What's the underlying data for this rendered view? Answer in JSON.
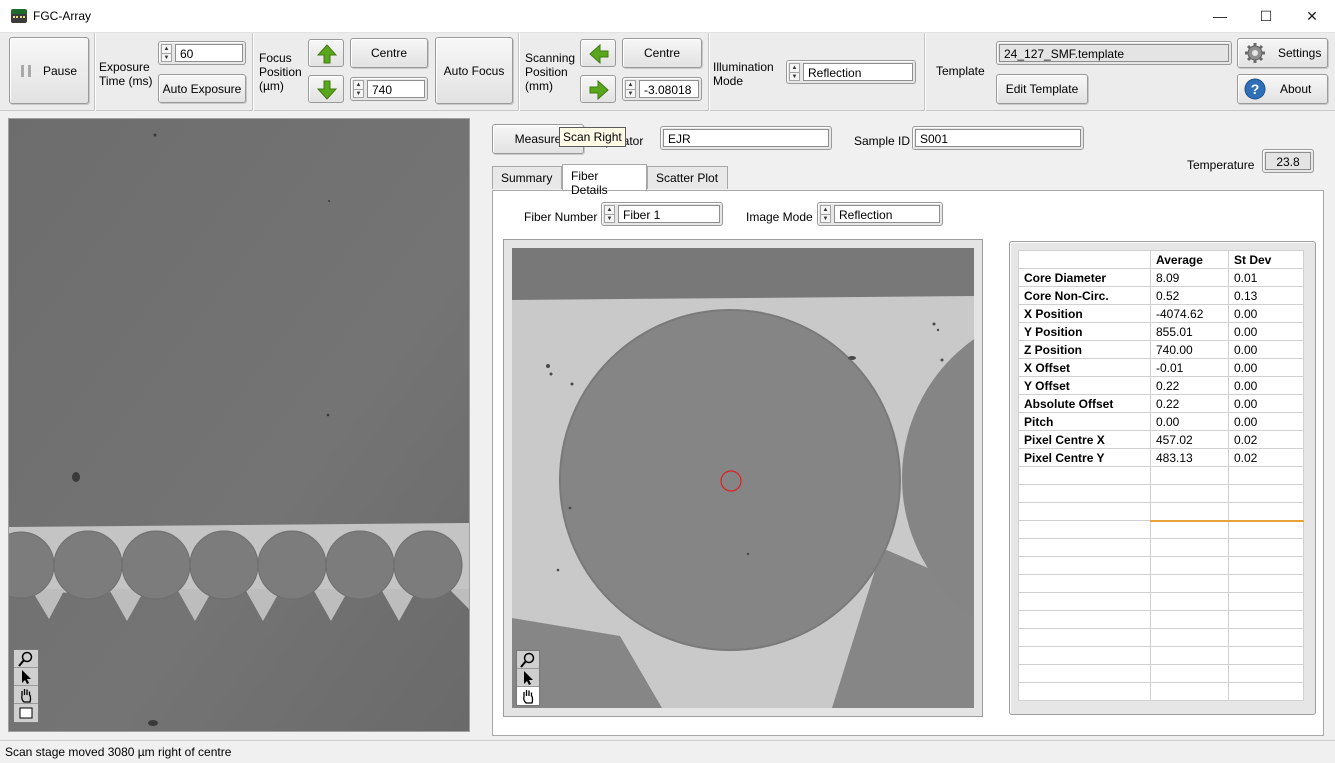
{
  "window": {
    "title": "FGC-Array",
    "controls": [
      "—",
      "☐",
      "✕"
    ]
  },
  "toolbar": {
    "pause_label": "Pause",
    "exposure_label": "Exposure Time (ms)",
    "exposure_value": "60",
    "auto_exposure_label": "Auto Exposure",
    "focus_label": "Focus Position (µm)",
    "focus_centre_label": "Centre",
    "focus_value": "740",
    "auto_focus_label": "Auto Focus",
    "scan_label": "Scanning Position (mm)",
    "scan_centre_label": "Centre",
    "scan_value": "-3.08018",
    "illumination_label": "Illumination Mode",
    "illumination_value": "Reflection",
    "template_label": "Template",
    "template_value": "24_127_SMF.template",
    "edit_template_label": "Edit Template",
    "settings_label": "Settings",
    "about_label": "About"
  },
  "measure": {
    "measure_label": "Measure",
    "operator_label": "Operator",
    "operator_value": "EJR",
    "sample_label": "Sample ID",
    "sample_value": "S001",
    "temperature_label": "Temperature",
    "temperature_value": "23.8"
  },
  "tooltip": "Scan Right",
  "tabs": [
    {
      "label": "Summary",
      "active": false
    },
    {
      "label": "Fiber Details",
      "active": true
    },
    {
      "label": "Scatter Plot",
      "active": false
    }
  ],
  "fiber_details": {
    "fiber_number_label": "Fiber Number",
    "fiber_number_value": "Fiber 1",
    "image_mode_label": "Image Mode",
    "image_mode_value": "Reflection"
  },
  "stats_table": {
    "headers": [
      "",
      "Average",
      "St Dev"
    ],
    "rows": [
      [
        "Core Diameter",
        "8.09",
        "0.01"
      ],
      [
        "Core Non-Circ.",
        "0.52",
        "0.13"
      ],
      [
        "X Position",
        "-4074.62",
        "0.00"
      ],
      [
        "Y Position",
        "855.01",
        "0.00"
      ],
      [
        "Z Position",
        "740.00",
        "0.00"
      ],
      [
        "X Offset",
        "-0.01",
        "0.00"
      ],
      [
        "Y Offset",
        "0.22",
        "0.00"
      ],
      [
        "Absolute Offset",
        "0.22",
        "0.00"
      ],
      [
        "Pitch",
        "0.00",
        "0.00"
      ],
      [
        "Pixel Centre X",
        "457.02",
        "0.02"
      ],
      [
        "Pixel Centre Y",
        "483.13",
        "0.02"
      ]
    ]
  },
  "status": "Scan stage moved 3080 µm right of centre",
  "colors": {
    "arrow_green": "#5aa61c",
    "marker_red": "#e02020",
    "highlight_orange": "#e8a23a"
  },
  "icons": {
    "tools": [
      "zoom-icon",
      "pointer-icon",
      "pan-hand-icon",
      "select-box-icon"
    ]
  }
}
